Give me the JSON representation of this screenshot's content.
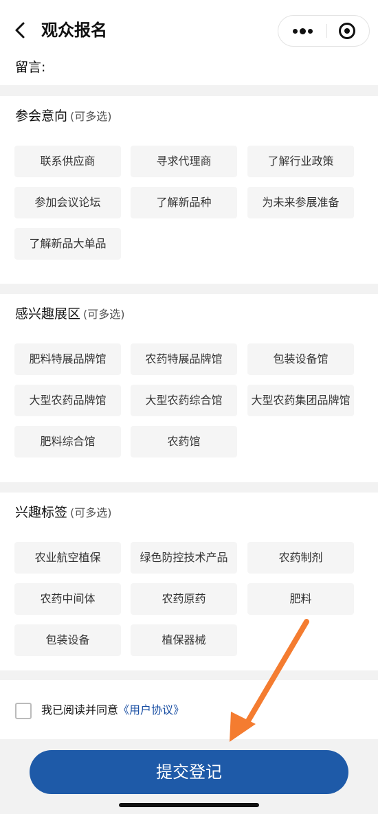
{
  "header": {
    "title": "观众报名",
    "back_icon": "chevron-left-icon"
  },
  "message": {
    "label": "留言:"
  },
  "sections": [
    {
      "title": "参会意向",
      "hint": "(可多选)",
      "options": [
        "联系供应商",
        "寻求代理商",
        "了解行业政策",
        "参加会议论坛",
        "了解新品种",
        "为未来参展准备",
        "了解新品大单品"
      ]
    },
    {
      "title": "感兴趣展区",
      "hint": "(可多选)",
      "options": [
        "肥料特展品牌馆",
        "农药特展品牌馆",
        "包装设备馆",
        "大型农药品牌馆",
        "大型农药综合馆",
        "大型农药集团品牌馆",
        "肥料综合馆",
        "农药馆"
      ]
    },
    {
      "title": "兴趣标签",
      "hint": "(可多选)",
      "options": [
        "农业航空植保",
        "绿色防控技术产品",
        "农药制剂",
        "农药中间体",
        "农药原药",
        "肥料",
        "包装设备",
        "植保器械"
      ]
    }
  ],
  "agreement": {
    "text": "我已阅读并同意",
    "link": "《用户协议》"
  },
  "submit": {
    "label": "提交登记"
  },
  "colors": {
    "primary": "#1e5aa8",
    "arrow": "#f47c30",
    "link": "#1a4fa3"
  }
}
